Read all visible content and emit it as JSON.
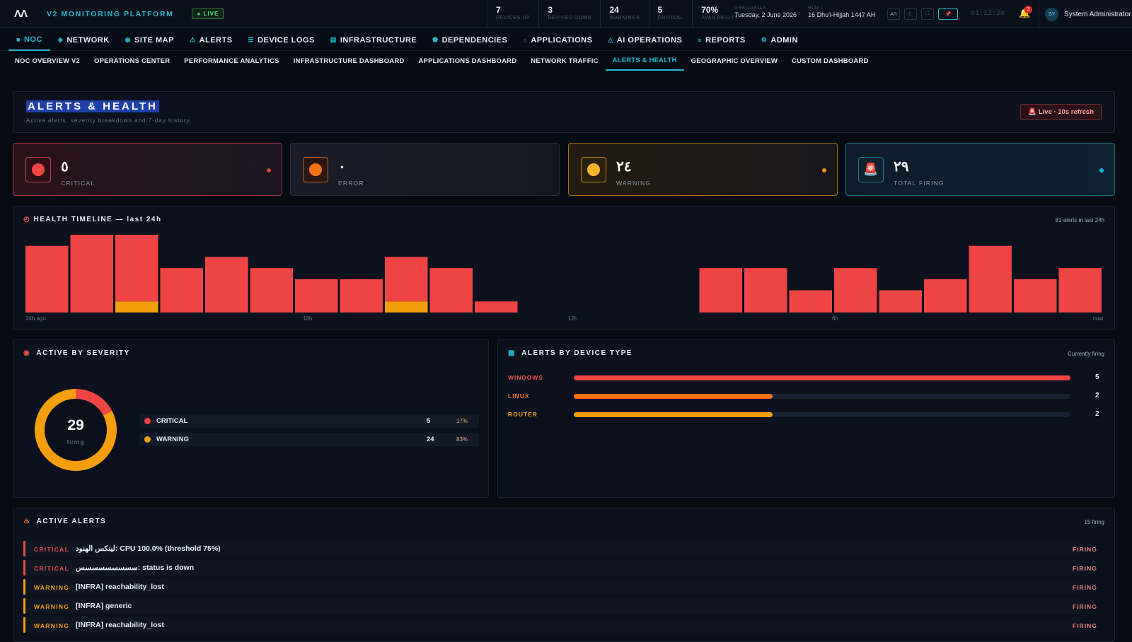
{
  "topbar": {
    "logo": "ΛΛ",
    "brand": "V2 MONITORING PLATFORM",
    "live": "● LIVE",
    "stats": [
      {
        "value": "7",
        "label": "DEVICES UP"
      },
      {
        "value": "3",
        "label": "DEVICES DOWN"
      },
      {
        "value": "24",
        "label": "WARNINGS"
      },
      {
        "value": "5",
        "label": "CRITICAL"
      },
      {
        "value": "70%",
        "label": "AVAILABILITY"
      }
    ],
    "gregorian_label": "GREGORIAN",
    "gregorian_date": "Tuesday, 2 June 2026",
    "hijri_label": "HIJRI",
    "hijri_date": "16 Dhu'l-Hijjah 1447 AH",
    "lang_button": "AR",
    "clock": "01:12:20",
    "notif_count": "3",
    "avatar": "SY",
    "user": "System Administrator"
  },
  "nav_primary": [
    {
      "icon": "■",
      "label": "NOC",
      "active": true
    },
    {
      "icon": "◆",
      "label": "NETWORK"
    },
    {
      "icon": "◉",
      "label": "SITE MAP"
    },
    {
      "icon": "⚠",
      "label": "ALERTS"
    },
    {
      "icon": "☰",
      "label": "DEVICE LOGS"
    },
    {
      "icon": "▤",
      "label": "INFRASTRUCTURE"
    },
    {
      "icon": "⬟",
      "label": "DEPENDENCIES"
    },
    {
      "icon": "○",
      "label": "APPLICATIONS"
    },
    {
      "icon": "△",
      "label": "AI OPERATIONS"
    },
    {
      "icon": "≡",
      "label": "REPORTS"
    },
    {
      "icon": "⚙",
      "label": "ADMIN"
    }
  ],
  "nav_secondary": [
    {
      "label": "NOC OVERVIEW V2"
    },
    {
      "label": "OPERATIONS CENTER"
    },
    {
      "label": "PERFORMANCE ANALYTICS"
    },
    {
      "label": "INFRASTRUCTURE DASHBOARD"
    },
    {
      "label": "APPLICATIONS DASHBOARD"
    },
    {
      "label": "NETWORK TRAFFIC"
    },
    {
      "label": "ALERTS & HEALTH",
      "active": true
    },
    {
      "label": "GEOGRAPHIC OVERVIEW"
    },
    {
      "label": "CUSTOM DASHBOARD"
    }
  ],
  "page": {
    "title": "ALERTS & HEALTH",
    "subtitle": "Active alerts, severity breakdown and 7-day history",
    "refresh": "Live · 10s refresh"
  },
  "kpis": [
    {
      "value": "٥",
      "label": "CRITICAL",
      "color": "#ef4444"
    },
    {
      "value": "٠",
      "label": "ERROR",
      "color": "#f97316"
    },
    {
      "value": "٢٤",
      "label": "WARNING",
      "color": "#f59e0b"
    },
    {
      "value": "٢٩",
      "label": "TOTAL FIRING",
      "color": "#06b6d4"
    }
  ],
  "timeline": {
    "title": "HEALTH TIMELINE — last 24h",
    "meta": "81 alerts in last 24h",
    "axis": [
      "24h ago",
      "18h",
      "12h",
      "6h",
      "now"
    ],
    "chart_data": {
      "type": "bar",
      "stacked": true,
      "series": [
        {
          "values": [
            6,
            7,
            6,
            4,
            5,
            4,
            3,
            3,
            4,
            4,
            1,
            0,
            0,
            0,
            0,
            4,
            4,
            2,
            4,
            2,
            3,
            6,
            3,
            4
          ],
          "color": "#ef4444"
        },
        {
          "values": [
            0,
            0,
            1,
            0,
            0,
            0,
            0,
            0,
            1,
            0,
            0,
            0,
            0,
            0,
            0,
            0,
            0,
            0,
            0,
            0,
            0,
            0,
            0,
            0
          ],
          "color": "#f59e0b"
        }
      ]
    }
  },
  "severity": {
    "title": "ACTIVE BY SEVERITY",
    "total": "29",
    "total_label": "firing",
    "chart_data": {
      "type": "pie",
      "labels": [
        "CRITICAL",
        "WARNING"
      ],
      "values": [
        5,
        24
      ],
      "colors": [
        "#ef4444",
        "#f59e0b"
      ]
    },
    "rows": [
      {
        "name": "CRITICAL",
        "count": "5",
        "pct": "17%",
        "color": "#ef4444"
      },
      {
        "name": "WARNING",
        "count": "24",
        "pct": "83%",
        "color": "#f59e0b"
      }
    ]
  },
  "device_types": {
    "title": "ALERTS BY DEVICE TYPE",
    "meta": "Currently firing",
    "max": 5,
    "rows": [
      {
        "name": "WINDOWS",
        "count": "5",
        "value": 5,
        "color": "#ef4444",
        "name_color": "#f05252"
      },
      {
        "name": "LINUX",
        "count": "2",
        "value": 2,
        "color": "#f97316",
        "name_color": "#f97316"
      },
      {
        "name": "ROUTER",
        "count": "2",
        "value": 2,
        "color": "#f59e0b",
        "name_color": "#f59e0b"
      }
    ]
  },
  "active_alerts": {
    "title": "ACTIVE ALERTS",
    "meta": "15 firing",
    "rows": [
      {
        "sev": "CRITICAL",
        "msg": "لينكس الهنود: CPU 100.0% (threshold 75%)",
        "status": "FIRING",
        "color": "#ef4444"
      },
      {
        "sev": "CRITICAL",
        "msg": "سسسسسسسسس: status is down",
        "status": "FIRING",
        "color": "#ef4444"
      },
      {
        "sev": "WARNING",
        "msg": "[INFRA] reachability_lost",
        "status": "FIRING",
        "color": "#f59e0b"
      },
      {
        "sev": "WARNING",
        "msg": "[INFRA] generic",
        "status": "FIRING",
        "color": "#f59e0b"
      },
      {
        "sev": "WARNING",
        "msg": "[INFRA] reachability_lost",
        "status": "FIRING",
        "color": "#f59e0b"
      }
    ]
  }
}
